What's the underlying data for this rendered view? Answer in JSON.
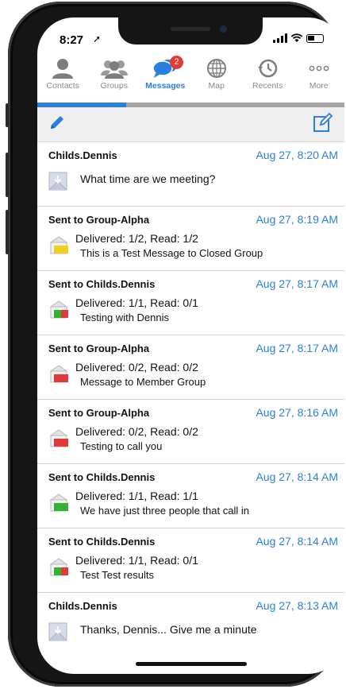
{
  "status_bar": {
    "time": "8:27"
  },
  "tabs": [
    {
      "label": "Contacts",
      "icon": "person-icon",
      "active": false
    },
    {
      "label": "Groups",
      "icon": "group-icon",
      "active": false
    },
    {
      "label": "Messages",
      "icon": "chat-bubble-icon",
      "active": true,
      "badge": "2"
    },
    {
      "label": "Map",
      "icon": "globe-icon",
      "active": false
    },
    {
      "label": "Recents",
      "icon": "history-icon",
      "active": false
    },
    {
      "label": "More",
      "icon": "ellipsis-icon",
      "active": false
    }
  ],
  "colors": {
    "accent": "#2a7fe0",
    "badge": "#e53935"
  },
  "messages": [
    {
      "who": "Childs.Dennis",
      "when": "Aug 27, 8:20 AM",
      "type": "received",
      "text": "What time are we meeting?"
    },
    {
      "who": "Sent to Group-Alpha",
      "when": "Aug 27, 8:19 AM",
      "type": "sent",
      "status": "yellow",
      "line1": "Delivered: 1/2, Read: 1/2",
      "line2": "This is a Test Message to Closed Group"
    },
    {
      "who": "Sent to Childs.Dennis",
      "when": "Aug 27, 8:17 AM",
      "type": "sent",
      "status": "green-red",
      "line1": "Delivered: 1/1, Read: 0/1",
      "line2": "Testing with Dennis"
    },
    {
      "who": "Sent to Group-Alpha",
      "when": "Aug 27, 8:17 AM",
      "type": "sent",
      "status": "red",
      "line1": "Delivered: 0/2, Read: 0/2",
      "line2": "Message to Member Group"
    },
    {
      "who": "Sent to Group-Alpha",
      "when": "Aug 27, 8:16 AM",
      "type": "sent",
      "status": "red",
      "line1": "Delivered: 0/2, Read: 0/2",
      "line2": "Testing to call you"
    },
    {
      "who": "Sent to Childs.Dennis",
      "when": "Aug 27, 8:14 AM",
      "type": "sent",
      "status": "green",
      "line1": "Delivered: 1/1, Read: 1/1",
      "line2": "We have just three people that call in"
    },
    {
      "who": "Sent to Childs.Dennis",
      "when": "Aug 27, 8:14 AM",
      "type": "sent",
      "status": "green-red",
      "line1": "Delivered: 1/1, Read: 0/1",
      "line2": "Test Test results"
    },
    {
      "who": "Childs.Dennis",
      "when": "Aug 27, 8:13 AM",
      "type": "received",
      "text": "Thanks, Dennis... Give me a minute"
    }
  ]
}
